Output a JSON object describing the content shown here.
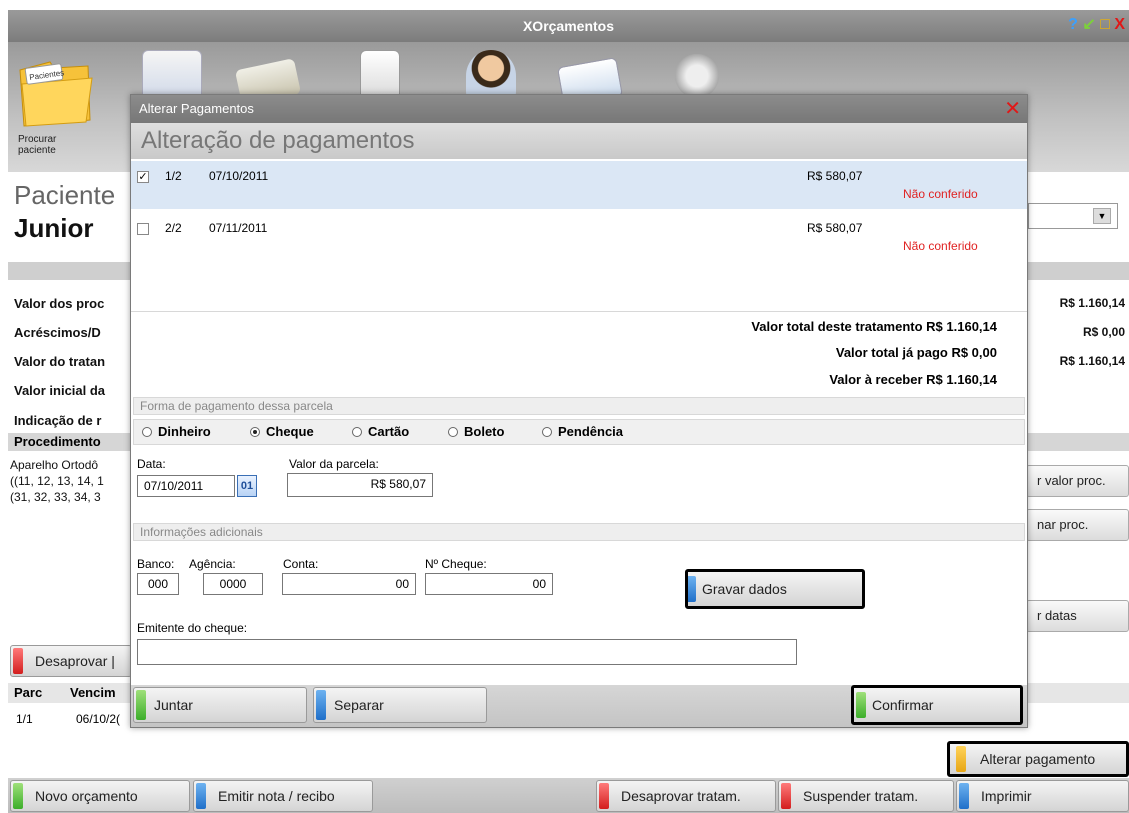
{
  "app": {
    "title": "XOrçamentos",
    "window_controls": [
      "?",
      "↙",
      "□",
      "X"
    ]
  },
  "toolbar": {
    "search_label": "Procurar paciente",
    "folder_label": "Pacientes"
  },
  "background": {
    "patient_label": "Paciente",
    "patient_name": "Junior",
    "summary_labels": [
      "Valor dos proc",
      "Acréscimos/D",
      "Valor do tratan",
      "Valor inicial da",
      "Indicação de r"
    ],
    "summary_values": [
      "R$ 1.160,14",
      "R$ 0,00",
      "R$ 1.160,14"
    ],
    "procedures_header": "Procedimento",
    "procedure_lines": [
      "Aparelho Ortodô",
      "((11, 12, 13, 14, 1",
      "(31, 32, 33, 34, 3"
    ],
    "side_buttons": [
      "r valor proc.",
      "nar proc.",
      "r datas"
    ],
    "disapprove_button": "Desaprovar |",
    "parc_header": [
      "Parc",
      "Vencim"
    ],
    "parc_row": [
      "1/1",
      "06/10/2("
    ]
  },
  "modal": {
    "title": "Alterar Pagamentos",
    "heading": "Alteração de pagamentos",
    "installments": [
      {
        "checked": true,
        "num": "1/2",
        "date": "07/10/2011",
        "amount": "R$ 580,07",
        "status": "Não conferido"
      },
      {
        "checked": false,
        "num": "2/2",
        "date": "07/11/2011",
        "amount": "R$ 580,07",
        "status": "Não conferido"
      }
    ],
    "totals": {
      "total_treatment": "Valor total deste tratamento R$ 1.160,14",
      "total_paid": "Valor total já pago R$ 0,00",
      "to_receive": "Valor à receber R$ 1.160,14"
    },
    "payment_section_title": "Forma de pagamento dessa parcela",
    "payment_options": [
      "Dinheiro",
      "Cheque",
      "Cartão",
      "Boleto",
      "Pendência"
    ],
    "selected_payment": "Cheque",
    "date_label": "Data:",
    "date_value": "07/10/2011",
    "calendar_label": "01",
    "installment_value_label": "Valor da parcela:",
    "installment_value": "R$ 580,07",
    "additional_info_title": "Informações adicionais",
    "bank_label": "Banco:",
    "bank_value": "000",
    "agency_label": "Agência:",
    "agency_value": "0000",
    "account_label": "Conta:",
    "account_value": "00",
    "check_no_label": "Nº Cheque:",
    "check_no_value": "00",
    "save_button": "Gravar dados",
    "issuer_label": "Emitente do cheque:",
    "issuer_value": "",
    "join_button": "Juntar",
    "split_button": "Separar",
    "confirm_button": "Confirmar"
  },
  "alter_payment_button": "Alterar pagamento",
  "bottom_buttons": [
    "Novo orçamento",
    "Emitir nota / recibo",
    "Desaprovar tratam.",
    "Suspender tratam.",
    "Imprimir"
  ],
  "colors": {
    "green": "#3cae2a",
    "blue": "#1f6fc9",
    "red": "#d31e1e",
    "orange": "#e7a615",
    "status_red": "#e02222",
    "selected_row": "#dbe7f5"
  }
}
